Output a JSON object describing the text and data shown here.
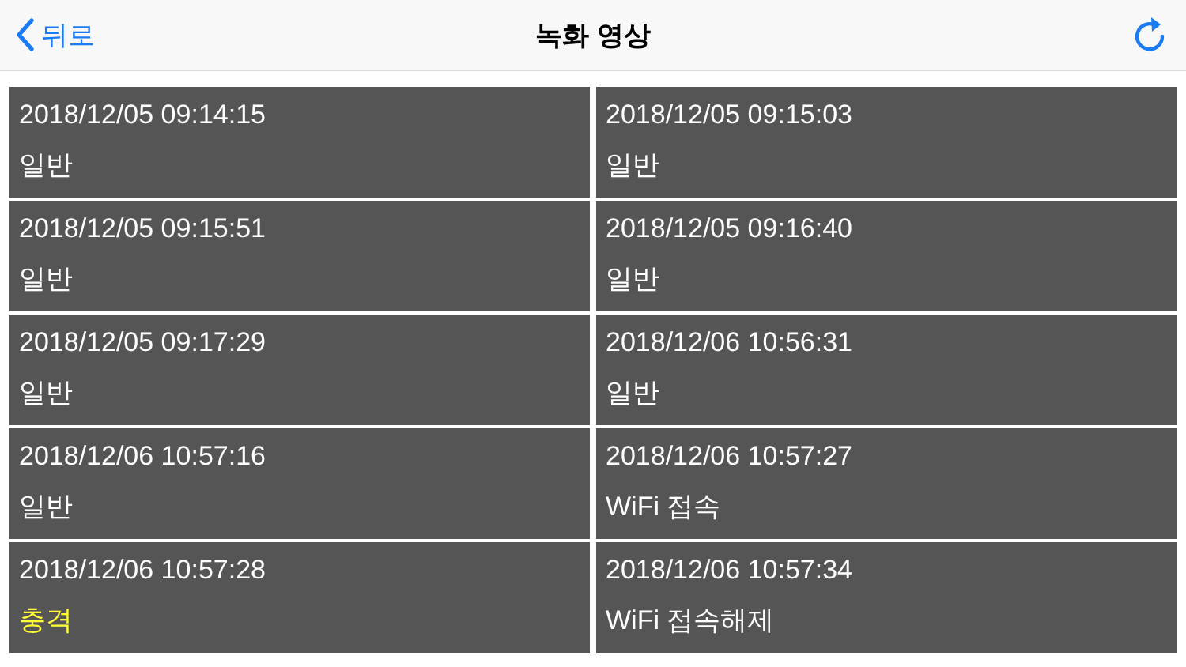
{
  "nav_bar": {
    "back_label": "뒤로",
    "title": "녹화 영상"
  },
  "clips": [
    {
      "time": "2018/12/05 09:14:15",
      "event": "일반",
      "color": "#ffffff"
    },
    {
      "time": "2018/12/05 09:15:03",
      "event": "일반",
      "color": "#ffffff"
    },
    {
      "time": "2018/12/05 09:15:51",
      "event": "일반",
      "color": "#ffffff"
    },
    {
      "time": "2018/12/05 09:16:40",
      "event": "일반",
      "color": "#ffffff"
    },
    {
      "time": "2018/12/05 09:17:29",
      "event": "일반",
      "color": "#ffffff"
    },
    {
      "time": "2018/12/06 10:56:31",
      "event": "일반",
      "color": "#ffffff"
    },
    {
      "time": "2018/12/06 10:57:16",
      "event": "일반",
      "color": "#ffffff"
    },
    {
      "time": "2018/12/06 10:57:27",
      "event": "WiFi 접속",
      "color": "#ffffff"
    },
    {
      "time": "2018/12/06 10:57:28",
      "event": "충격",
      "color": "#ffff33"
    },
    {
      "time": "2018/12/06 10:57:34",
      "event": "WiFi 접속해제",
      "color": "#ffffff"
    }
  ]
}
